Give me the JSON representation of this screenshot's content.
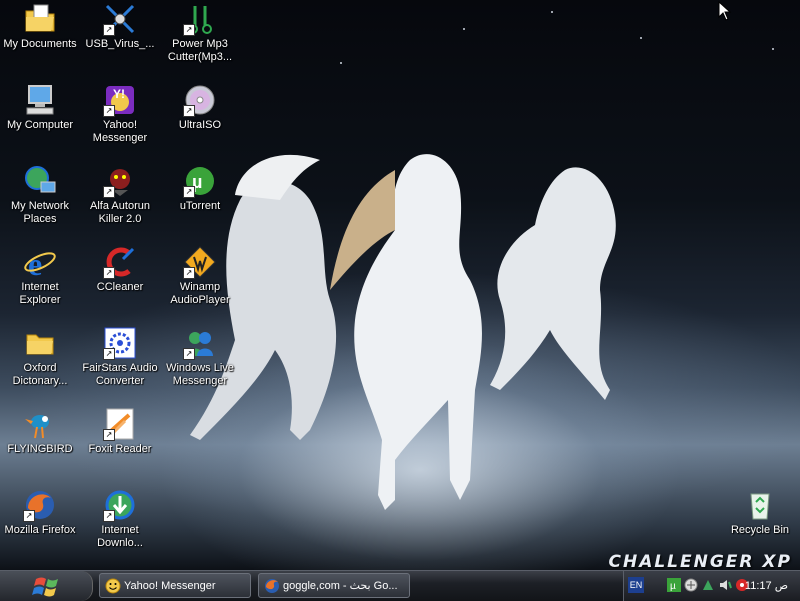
{
  "desktop": {
    "brand": "CHALLENGER XP",
    "icons": [
      {
        "label": "My Documents",
        "icon": "folder-documents-icon"
      },
      {
        "label": "My Computer",
        "icon": "computer-icon"
      },
      {
        "label": "My Network Places",
        "icon": "network-places-icon"
      },
      {
        "label": "Internet Explorer",
        "icon": "internet-explorer-icon"
      },
      {
        "label": "Oxford Dictonary...",
        "icon": "folder-icon"
      },
      {
        "label": "FLYINGBIRD",
        "icon": "bird-icon"
      },
      {
        "label": "Mozilla Firefox",
        "icon": "firefox-icon"
      },
      {
        "label": "USB_Virus_...",
        "icon": "usb-virus-icon"
      },
      {
        "label": "Yahoo! Messenger",
        "icon": "yahoo-messenger-icon"
      },
      {
        "label": "Alfa Autorun Killer 2.0",
        "icon": "autorun-killer-icon"
      },
      {
        "label": "CCleaner",
        "icon": "ccleaner-icon"
      },
      {
        "label": "FairStars Audio Converter",
        "icon": "audio-converter-icon"
      },
      {
        "label": "Foxit Reader",
        "icon": "foxit-reader-icon"
      },
      {
        "label": "Internet Downlo...",
        "icon": "download-manager-icon"
      },
      {
        "label": "Power Mp3 Cutter(Mp3...",
        "icon": "mp3-cutter-icon"
      },
      {
        "label": "UltraISO",
        "icon": "disc-icon"
      },
      {
        "label": "uTorrent",
        "icon": "utorrent-icon"
      },
      {
        "label": "Winamp AudioPlayer",
        "icon": "winamp-icon"
      },
      {
        "label": "Windows Live Messenger",
        "icon": "live-messenger-icon"
      },
      {
        "label": "Recycle Bin",
        "icon": "recycle-bin-icon"
      }
    ]
  },
  "taskbar": {
    "tasks": [
      {
        "label": "Yahoo! Messenger",
        "icon": "yahoo-smiley-icon"
      },
      {
        "label": "goggle,com - بحث Go...",
        "icon": "firefox-icon"
      }
    ],
    "tray": {
      "language": "EN",
      "clock": "11:17 ص"
    }
  },
  "colors": {
    "label_text": "#ffffff",
    "taskbar": "#1d2026",
    "yahoo": "#7b2cbf",
    "ie_blue": "#1e6fd9"
  }
}
